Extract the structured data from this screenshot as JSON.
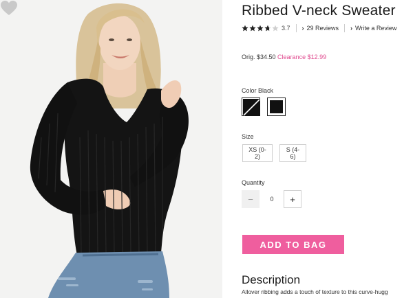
{
  "product": {
    "title": "Ribbed V-neck Sweater",
    "rating": 3.7,
    "rating_text": "3.7",
    "reviews_link": "29 Reviews",
    "write_review_link": "Write a Review",
    "price": {
      "original_label": "Orig. $34.50",
      "clearance_label": "Clearance $12.99"
    },
    "color": {
      "label": "Color Black",
      "swatches": [
        "no-image-swatch",
        "black"
      ]
    },
    "size": {
      "label": "Size",
      "options": [
        "XS (0-2)",
        "S (4-6)"
      ]
    },
    "quantity": {
      "label": "Quantity",
      "value": "0",
      "minus": "−",
      "plus": "+"
    },
    "add_to_bag": "ADD TO BAG",
    "description": {
      "heading": "Description",
      "text": "Allover ribbing adds a touch of texture to this curve-hugg"
    }
  },
  "colors": {
    "accent": "#ef5e9e",
    "clearance": "#e04a8f",
    "photo_background": "#f3f3f2"
  },
  "icons": {
    "favorite": "heart-icon",
    "star": "star-icon",
    "chevron": "chevron-right-icon"
  }
}
